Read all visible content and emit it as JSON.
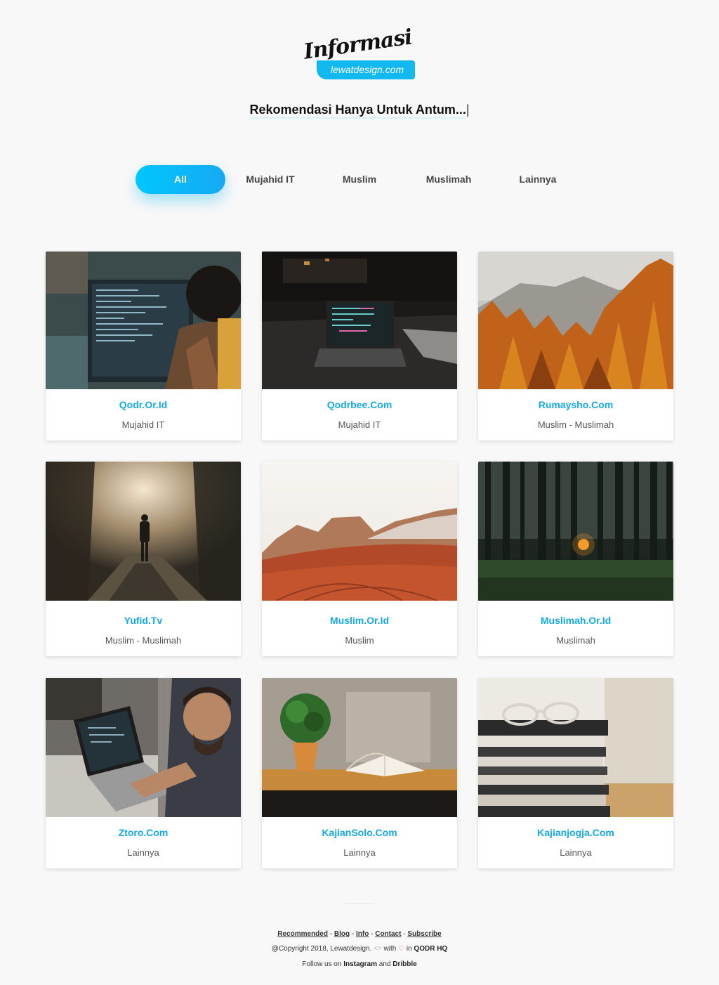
{
  "logo": {
    "script": "Informasi",
    "badge": "lewatdesign.com"
  },
  "tagline": {
    "text": "Rekomendasi Hanya Untuk Antum...",
    "cursor": "|"
  },
  "filters": [
    {
      "label": "All",
      "active": true
    },
    {
      "label": "Mujahid IT",
      "active": false
    },
    {
      "label": "Muslim",
      "active": false
    },
    {
      "label": "Muslimah",
      "active": false
    },
    {
      "label": "Lainnya",
      "active": false
    }
  ],
  "cards": [
    {
      "title": "Qodr.Or.Id",
      "category": "Mujahid IT"
    },
    {
      "title": "Qodrbee.Com",
      "category": "Mujahid IT"
    },
    {
      "title": "Rumaysho.Com",
      "category": "Muslim - Muslimah"
    },
    {
      "title": "Yufid.Tv",
      "category": "Muslim - Muslimah"
    },
    {
      "title": "Muslim.Or.Id",
      "category": "Muslim"
    },
    {
      "title": "Muslimah.Or.Id",
      "category": "Muslimah"
    },
    {
      "title": "Ztoro.Com",
      "category": "Lainnya"
    },
    {
      "title": "KajianSolo.Com",
      "category": "Lainnya"
    },
    {
      "title": "Kajianjogja.Com",
      "category": "Lainnya"
    }
  ],
  "footer": {
    "links": [
      "Recommended",
      "Blog",
      "Info",
      "Contact",
      "Subscribe"
    ],
    "separator": "-",
    "copyright": "@Copyright 2018, Lewatdesign.",
    "code_glyph": "<>",
    "with": "with",
    "heart_glyph": "♡",
    "in_text": "in",
    "hq": "QODR HQ",
    "follow_prefix": "Follow us on",
    "instagram": "Instagram",
    "and": "and",
    "dribble": "Dribble"
  },
  "colors": {
    "accent": "#14a9e6",
    "tab_gradient_start": "#00c6fb",
    "tab_gradient_end": "#17a9f5"
  }
}
